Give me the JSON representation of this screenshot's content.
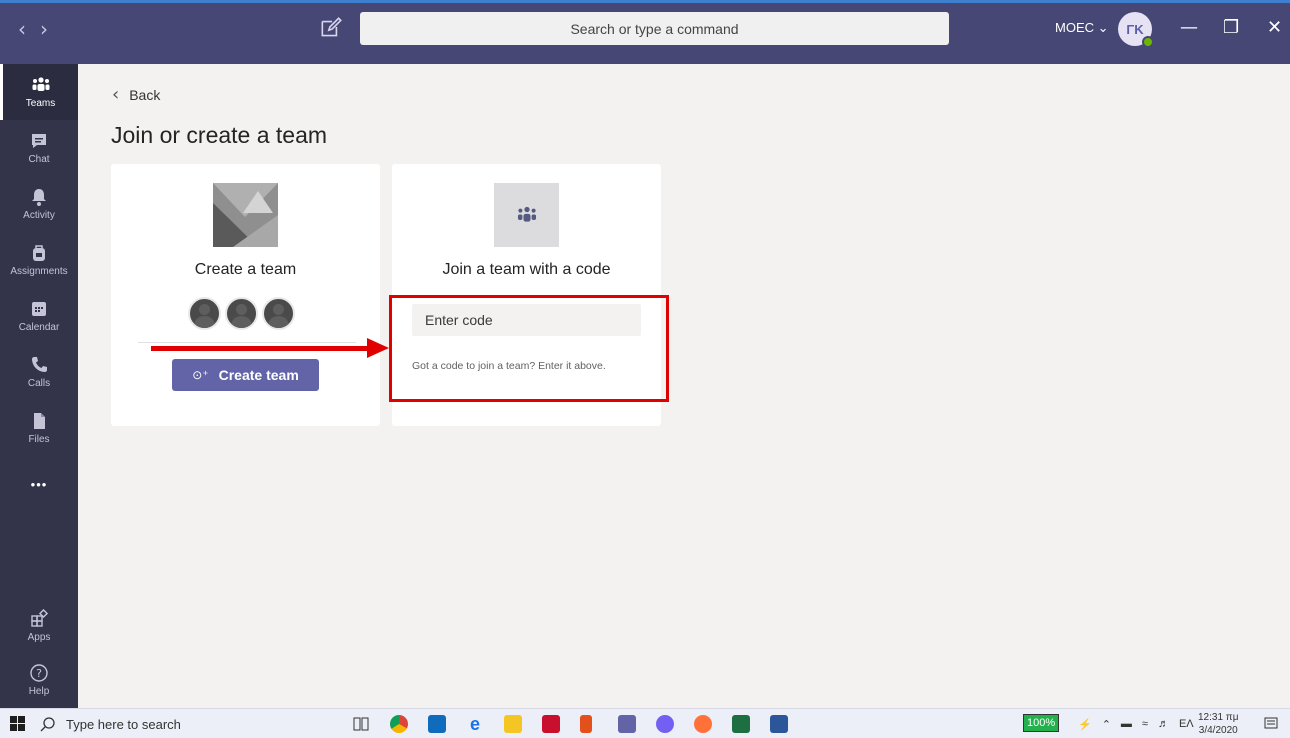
{
  "titlebar": {
    "search_placeholder": "Search or type a command",
    "org_label": "MOEC ⌄",
    "avatar_initials": "ΓΚ",
    "back_arrow": "‹",
    "forward_arrow": "›",
    "minimize": "—",
    "restore": "❐",
    "close": "✕"
  },
  "rail": {
    "items": [
      {
        "label": "Teams",
        "icon": "teams-icon"
      },
      {
        "label": "Chat",
        "icon": "chat-icon"
      },
      {
        "label": "Activity",
        "icon": "bell-icon"
      },
      {
        "label": "Assignments",
        "icon": "backpack-icon"
      },
      {
        "label": "Calendar",
        "icon": "calendar-icon"
      },
      {
        "label": "Calls",
        "icon": "phone-icon"
      },
      {
        "label": "Files",
        "icon": "file-icon"
      },
      {
        "label": "Apps",
        "icon": "apps-icon"
      },
      {
        "label": "Help",
        "icon": "help-icon"
      }
    ],
    "more": "•••"
  },
  "main": {
    "back_label": "Back",
    "title": "Join or create a team",
    "create_card": {
      "title": "Create a team",
      "button_label": "Create team"
    },
    "join_card": {
      "title": "Join a team with a code",
      "input_placeholder": "Enter code",
      "hint": "Got a code to join a team? Enter it above."
    }
  },
  "taskbar": {
    "search_text": "Type here to search",
    "battery": "100%",
    "language": "ΕΛ",
    "time": "12:31 πμ",
    "date": "3/4/2020"
  },
  "colors": {
    "titlebar": "#464775",
    "rail": "#33344a",
    "accent": "#6264a7",
    "annotation": "#e00000"
  }
}
